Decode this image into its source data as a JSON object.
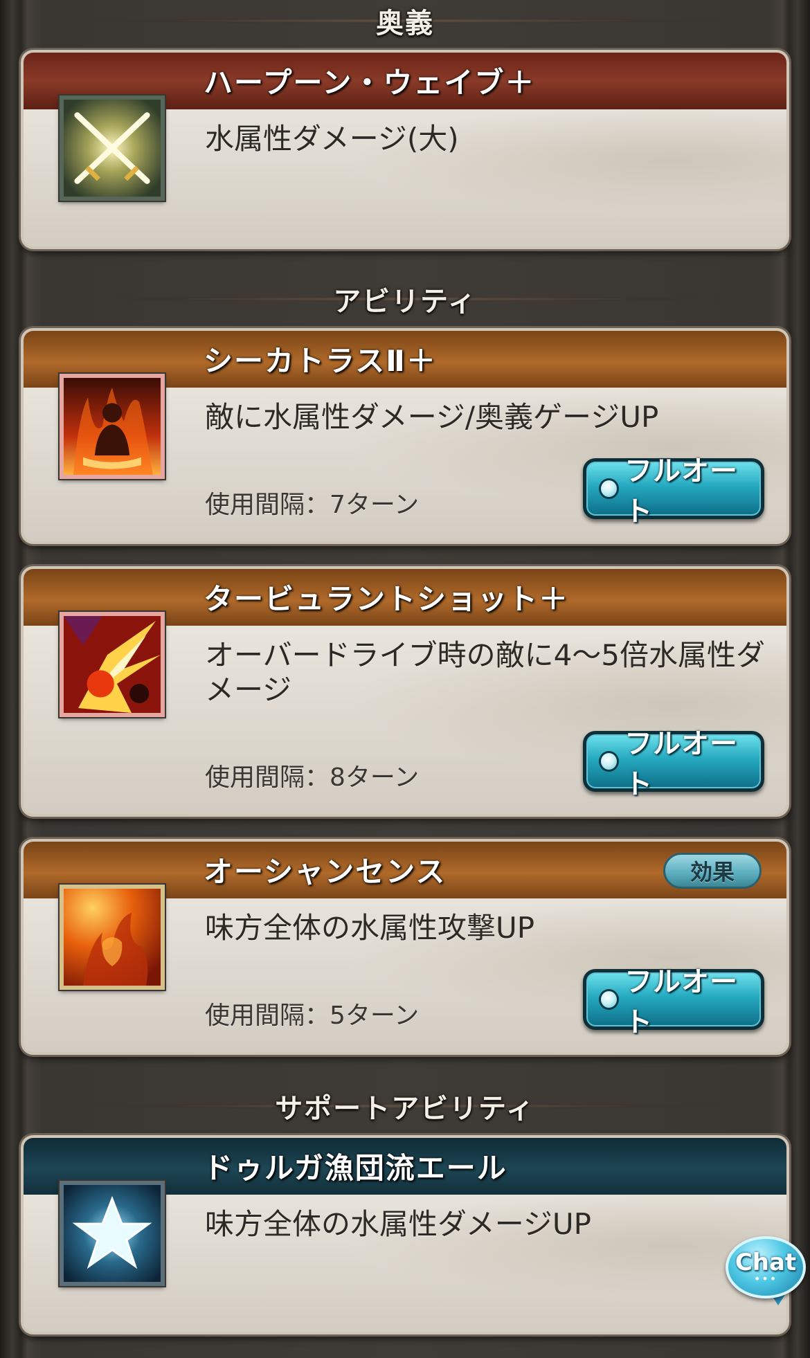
{
  "sections": {
    "ougi": "奥義",
    "abilities": "アビリティ",
    "support": "サポートアビリティ"
  },
  "ougi": {
    "name": "ハープーン・ウェイブ＋",
    "desc": "水属性ダメージ(大)",
    "icon": "crossed-swords-icon"
  },
  "abilities": [
    {
      "name": "シーカトラスⅡ＋",
      "desc": "敵に水属性ダメージ/奥義ゲージUP",
      "cooldown": "使用間隔：7ターン",
      "auto_label": "フルオート",
      "icon": "fire-figure-icon"
    },
    {
      "name": "タービュラントショット＋",
      "desc": "オーバードライブ時の敵に4〜5倍水属性ダメージ",
      "cooldown": "使用間隔：8ターン",
      "auto_label": "フルオート",
      "icon": "burst-strike-icon"
    },
    {
      "name": "オーシャンセンス",
      "desc": "味方全体の水属性攻撃UP",
      "cooldown": "使用間隔：5ターン",
      "auto_label": "フルオート",
      "effect_label": "効果",
      "icon": "flame-aura-icon"
    }
  ],
  "support": {
    "name": "ドゥルガ漁団流エール",
    "desc": "味方全体の水属性ダメージUP",
    "icon": "star-icon"
  },
  "chat": {
    "label": "Chat",
    "dots": "•••"
  },
  "colors": {
    "ougi_band": "#8a3a28",
    "ability_band": "#b06a2a",
    "support_band": "#1d4654",
    "auto_button": "#25a9c0"
  }
}
